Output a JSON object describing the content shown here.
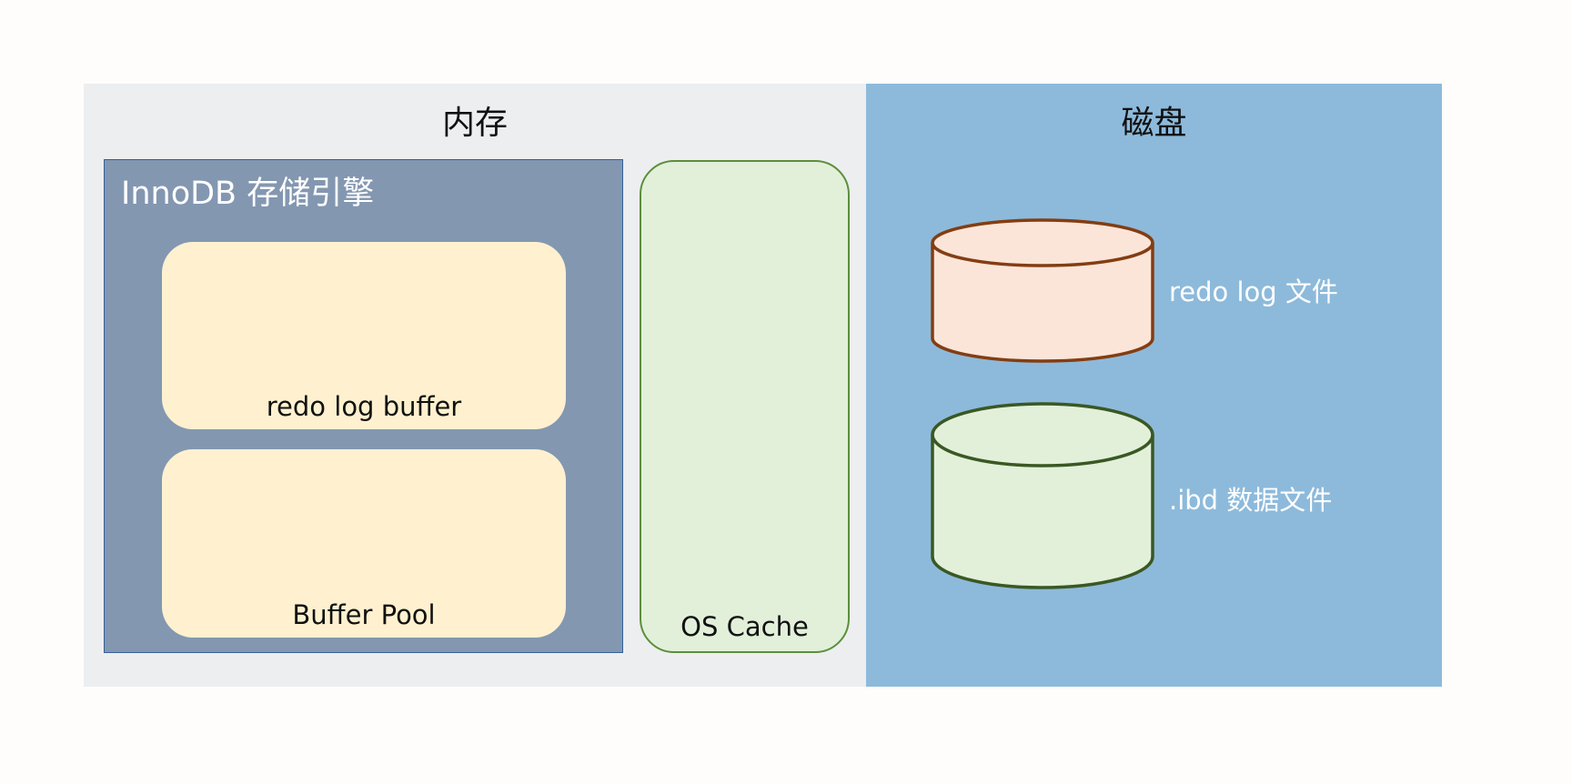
{
  "memory": {
    "title": "内存"
  },
  "disk": {
    "title": "磁盘"
  },
  "innodb": {
    "title": "InnoDB 存储引擎",
    "redo_log_buffer": "redo log buffer",
    "buffer_pool": "Buffer Pool"
  },
  "os_cache": {
    "label": "OS Cache"
  },
  "files": {
    "redo_log": "redo log 文件",
    "ibd": ".ibd 数据文件"
  },
  "colors": {
    "memory_bg": "#edeef0",
    "disk_bg": "#8dbadb",
    "innodb_bg": "#8397b1",
    "buffer_bg": "#fff1cf",
    "os_cache_bg": "#e2f0da",
    "redo_cylinder_fill": "#fbe5d9",
    "redo_cylinder_stroke": "#843d12",
    "ibd_cylinder_fill": "#e2f0da",
    "ibd_cylinder_stroke": "#3a5823"
  }
}
